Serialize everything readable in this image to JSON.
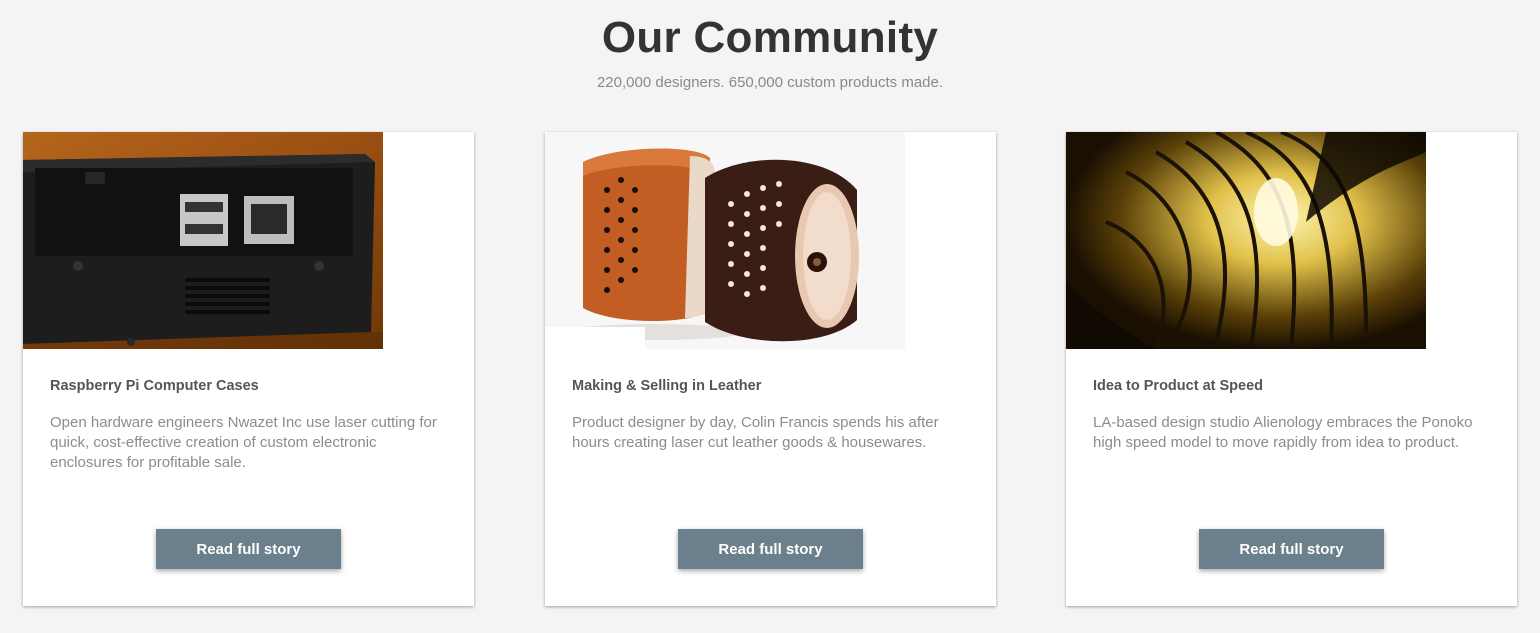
{
  "header": {
    "title": "Our Community",
    "subtitle": "220,000 designers. 650,000 custom products made."
  },
  "stories": [
    {
      "title": "Raspberry Pi Computer Cases",
      "text": "Open hardware engineers Nwazet Inc use laser cutting for quick, cost-effective creation of custom electronic enclosures for profitable sale.",
      "button_label": "Read full story"
    },
    {
      "title": "Making & Selling in Leather",
      "text": "Product designer by day, Colin Francis spends his after hours creating laser cut leather goods & housewares.",
      "button_label": "Read full story"
    },
    {
      "title": "Idea to Product at Speed",
      "text": "LA-based design studio Alienology embraces the Ponoko high speed model to move rapidly from idea to product.",
      "button_label": "Read full story"
    }
  ],
  "colors": {
    "background": "#f4f4f4",
    "button": "#6b7f8c",
    "title": "#333333",
    "muted_text": "#8c8c8c"
  }
}
